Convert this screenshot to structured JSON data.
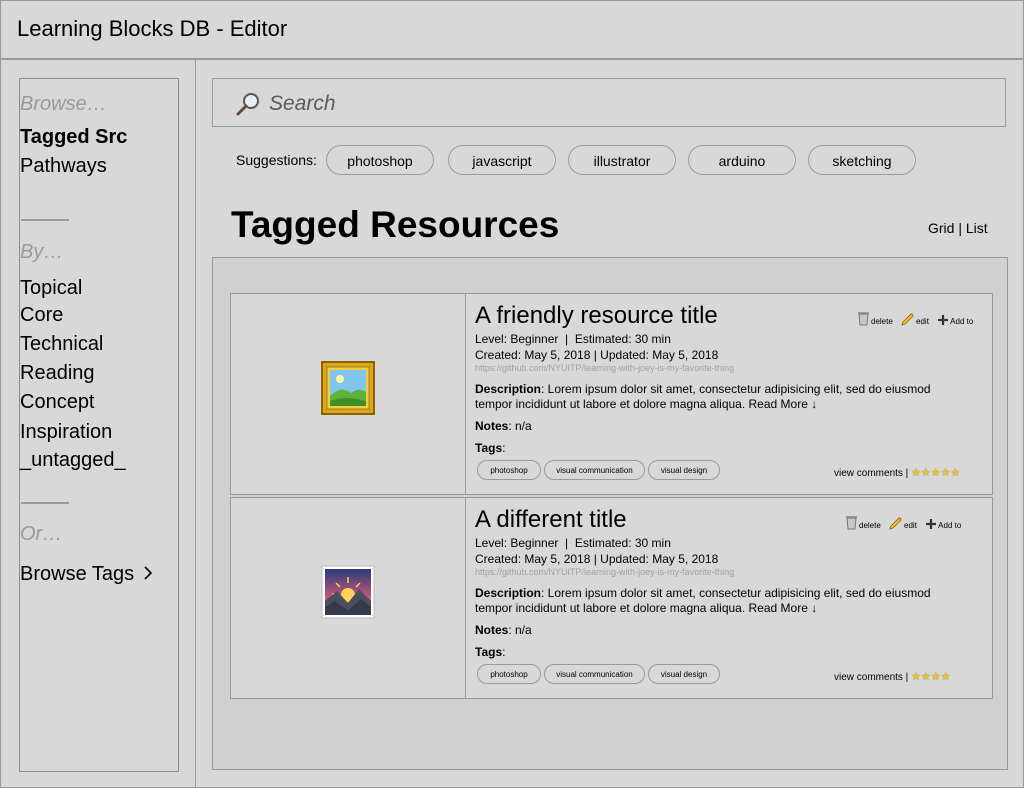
{
  "app": {
    "title": "Learning Blocks DB - Editor"
  },
  "sidebar": {
    "browse_heading": "Browse…",
    "browse_items": [
      {
        "label": "Tagged Src"
      },
      {
        "label": "Pathways"
      }
    ],
    "by_heading": "By…",
    "by_items": [
      {
        "label": "Topical"
      },
      {
        "label": "Core"
      },
      {
        "label": "Technical"
      },
      {
        "label": "Reading"
      },
      {
        "label": "Concept"
      },
      {
        "label": "Inspiration"
      },
      {
        "label": "_untagged_"
      }
    ],
    "or_heading": "Or…",
    "browse_tags": "Browse Tags"
  },
  "search": {
    "placeholder": "Search",
    "icon": "search-icon"
  },
  "suggestions": {
    "label": "Suggestions:",
    "items": [
      "photoshop",
      "javascript",
      "illustrator",
      "arduino",
      "sketching"
    ]
  },
  "page": {
    "title": "Tagged Resources",
    "view_grid": "Grid",
    "view_sep": " | ",
    "view_list": "List"
  },
  "resources": [
    {
      "title": "A friendly resource title",
      "level": "Level: Beginner  |  Estimated: 30 min",
      "dates": "Created: May 5, 2018 | Updated: May 5, 2018",
      "url": "https://github.com/NYUITP/learning-with-joey-is-my-favorite-thing",
      "desc_label": "Description",
      "desc_text": ": Lorem ipsum dolor sit amet, consectetur adipisicing elit, sed do eiusmod tempor incididunt ut labore et dolore magna aliqua. Read More ↓",
      "notes_label": "Notes",
      "notes_text": ": n/a",
      "tags_label": "Tags",
      "tags_colon": ":",
      "tags": [
        "photoshop",
        "visual communication",
        "visual design"
      ],
      "actions": {
        "delete": "delete",
        "edit": "edit",
        "add": "Add to"
      },
      "comments": "view comments | ",
      "rating": 5,
      "stars_text": "★★★★★",
      "thumbnail": "framed-landscape-picture-icon"
    },
    {
      "title": "A different title",
      "level": "Level: Beginner  |  Estimated: 30 min",
      "dates": "Created: May 5, 2018 | Updated: May 5, 2018",
      "url": "https://github.com/NYUITP/learning-with-joey-is-my-favorite-thing",
      "desc_label": "Description",
      "desc_text": ": Lorem ipsum dolor sit amet, consectetur adipisicing elit, sed do eiusmod tempor incididunt ut labore et dolore magna aliqua. Read More ↓",
      "notes_label": "Notes",
      "notes_text": ": n/a",
      "tags_label": "Tags",
      "tags_colon": ":",
      "tags": [
        "photoshop",
        "visual communication",
        "visual design"
      ],
      "actions": {
        "delete": "delete",
        "edit": "edit",
        "add": "Add to"
      },
      "comments": "view comments | ",
      "rating": 4,
      "stars_text": "★★★★",
      "thumbnail": "sunrise-over-mountains-picture-icon"
    }
  ],
  "colors": {
    "background": "#d8d8d8",
    "border": "#9a9a9a",
    "star": "#e6c23a"
  }
}
